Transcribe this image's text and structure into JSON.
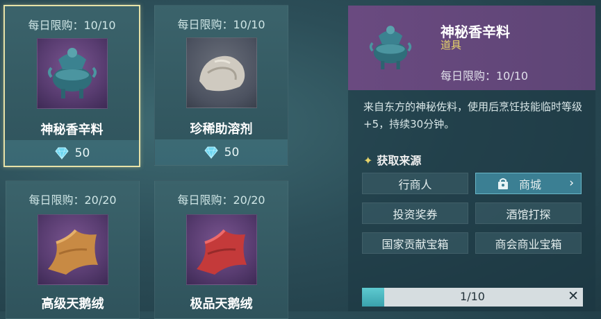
{
  "items": [
    {
      "limit_label": "每日限购：",
      "limit_value": "10/10",
      "name": "神秘香辛料",
      "price": "50",
      "icon": "censer-icon",
      "selected": true
    },
    {
      "limit_label": "每日限购：",
      "limit_value": "10/10",
      "name": "珍稀助溶剂",
      "price": "50",
      "icon": "rock-icon",
      "selected": false
    },
    {
      "limit_label": "每日限购：",
      "limit_value": "20/20",
      "name": "高级天鹅绒",
      "icon": "velvet-icon"
    },
    {
      "limit_label": "每日限购：",
      "limit_value": "20/20",
      "name": "极品天鹅绒",
      "icon": "velvet-icon"
    }
  ],
  "detail": {
    "name": "神秘香辛料",
    "category": "道具",
    "limit": "每日限购：10/10",
    "description": "来自东方的神秘佐料，使用后烹饪技能临时等级+5，持续30分钟。",
    "sources_title": "获取来源",
    "sources": [
      "行商人",
      "商城",
      "投资奖券",
      "酒馆打探",
      "国家贡献宝箱",
      "商会商业宝箱"
    ],
    "progress_text": "1/10",
    "progress_fraction": 0.1,
    "close_symbol": "✕",
    "chevron_symbol": "›"
  },
  "colors": {
    "accent_gold": "#e6d36a",
    "selected_border": "#e7e2a8",
    "diamond": "#6fd6f0"
  }
}
